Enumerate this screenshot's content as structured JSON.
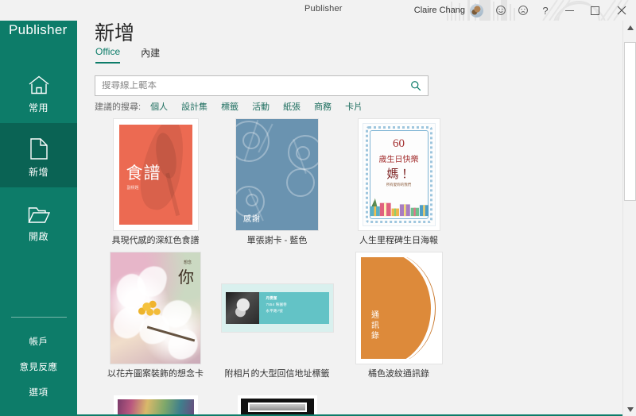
{
  "titlebar": {
    "app_title": "Publisher",
    "user_name": "Claire Chang",
    "avatar_icon": "user-avatar",
    "feedback_happy_icon": "smiley-face-icon",
    "feedback_sad_icon": "frowning-face-icon",
    "help_icon": "question-mark-icon",
    "minimize_icon": "minimize-icon",
    "restore_icon": "restore-window-icon",
    "close_icon": "close-x-icon"
  },
  "sidebar": {
    "brand": "Publisher",
    "items": [
      {
        "label": "常用",
        "icon": "home-icon",
        "active": false
      },
      {
        "label": "新增",
        "icon": "new-document-icon",
        "active": true
      },
      {
        "label": "開啟",
        "icon": "open-folder-icon",
        "active": false
      }
    ],
    "bottom_items": [
      {
        "label": "帳戶"
      },
      {
        "label": "意見反應"
      },
      {
        "label": "選項"
      }
    ]
  },
  "main": {
    "page_title": "新增",
    "tabs": [
      {
        "label": "Office",
        "active": true
      },
      {
        "label": "內建",
        "active": false
      }
    ],
    "search": {
      "placeholder": "搜尋線上範本",
      "value": "",
      "icon": "search-icon"
    },
    "suggested": {
      "label": "建議的搜尋:",
      "links": [
        "個人",
        "設計集",
        "標籤",
        "活動",
        "紙張",
        "商務",
        "卡片"
      ]
    },
    "templates": [
      {
        "caption": "具現代感的深紅色食譜",
        "thumb_kind": "recipe",
        "thumb_title": "食譜",
        "thumb_sub": "副標題",
        "accent": "#ec6a52"
      },
      {
        "caption": "單張謝卡 - 藍色",
        "thumb_kind": "thanks",
        "thumb_title": "感謝",
        "accent": "#6a93b0"
      },
      {
        "caption": "人生里程碑生日海報",
        "thumb_kind": "birthday",
        "number": "60",
        "line1": "歲生日快樂",
        "line2": "媽！",
        "line3": "所有愛妳的我們",
        "accent": "#a32f2f"
      },
      {
        "caption": "以花卉圖案裝飾的想念卡",
        "thumb_kind": "flower",
        "mini": "想念",
        "big": "你",
        "accent": "#d7a8bd"
      },
      {
        "caption": "附相片的大型回信地址標籤",
        "thumb_kind": "label",
        "name_line": "丹雯潔",
        "addr_line1": "7554 映園巷",
        "addr_line2": "永平路7號",
        "accent": "#63c3c6"
      },
      {
        "caption": "橘色波紋通訊錄",
        "thumb_kind": "book",
        "thumb_title": "通訊錄",
        "accent": "#dd8a3a"
      }
    ]
  },
  "scrollbar": {
    "up_icon": "scroll-up-arrow-icon",
    "down_icon": "scroll-down-arrow-icon"
  },
  "theme": {
    "brand_green": "#0d7c69",
    "brand_green_dark": "#0a6354",
    "page_bg": "#f2f2f2"
  }
}
